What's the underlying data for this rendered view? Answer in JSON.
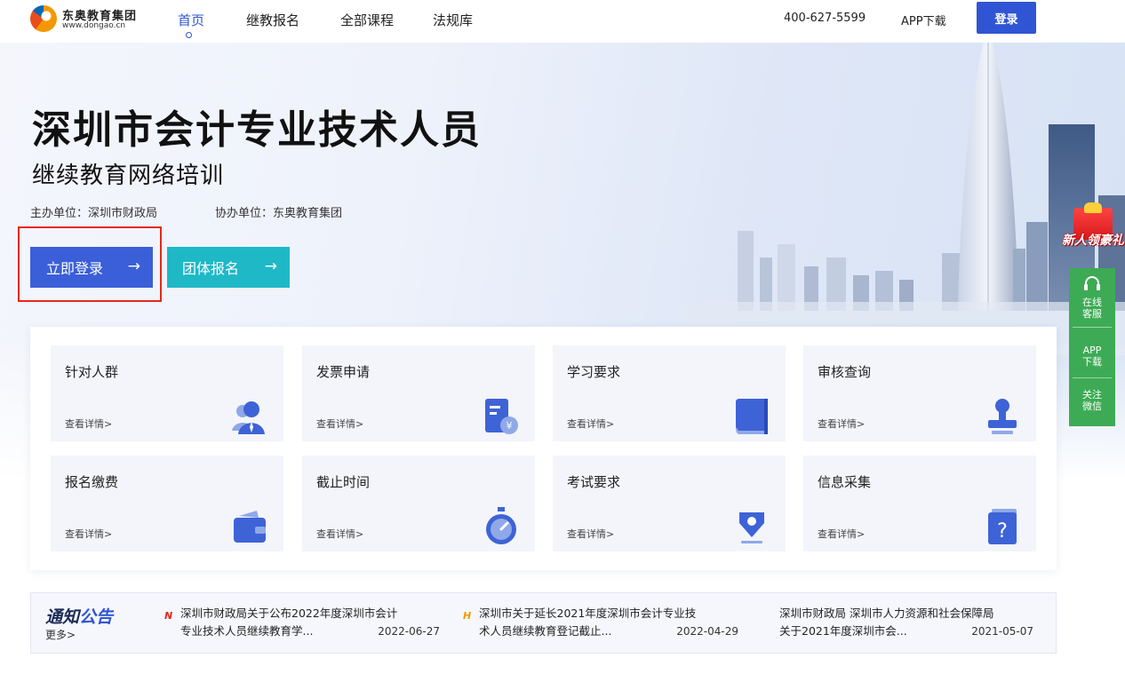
{
  "header": {
    "logo": {
      "name_cn": "东奥教育集团",
      "url_text": "www.dongao.cn"
    },
    "nav": [
      {
        "label": "首页",
        "active": true
      },
      {
        "label": "继教报名",
        "active": false
      },
      {
        "label": "全部课程",
        "active": false
      },
      {
        "label": "法规库",
        "active": false
      }
    ],
    "phone": "400-627-5599",
    "app_download": "APP下载",
    "login": "登录"
  },
  "hero": {
    "title": "深圳市会计专业技术人员",
    "subtitle": "继续教育网络培训",
    "organizer": "主办单位：深圳市财政局",
    "co_organizer": "协办单位：东奥教育集团",
    "cta_login": "立即登录",
    "cta_group": "团体报名",
    "arrow": "→"
  },
  "side": {
    "gift_text": "新人领豪礼",
    "items": [
      "在线\n客服",
      "APP\n下载",
      "关注\n微信"
    ]
  },
  "cards": [
    {
      "title": "针对人群",
      "link": "查看详情>",
      "icon": "people-icon"
    },
    {
      "title": "发票申请",
      "link": "查看详情>",
      "icon": "invoice-icon"
    },
    {
      "title": "学习要求",
      "link": "查看详情>",
      "icon": "book-icon"
    },
    {
      "title": "审核查询",
      "link": "查看详情>",
      "icon": "stamp-icon"
    },
    {
      "title": "报名缴费",
      "link": "查看详情>",
      "icon": "wallet-icon"
    },
    {
      "title": "截止时间",
      "link": "查看详情>",
      "icon": "stopwatch-icon"
    },
    {
      "title": "考试要求",
      "link": "查看详情>",
      "icon": "pen-icon"
    },
    {
      "title": "信息采集",
      "link": "查看详情>",
      "icon": "question-icon"
    }
  ],
  "notice": {
    "label_a": "通知",
    "label_b": "公告",
    "more": "更多>",
    "items": [
      {
        "badge": "N",
        "badge_color": "#e8261c",
        "line1": "深圳市财政局关于公布2022年度深圳市会计",
        "line2": "专业技术人员继续教育学...",
        "date": "2022-06-27"
      },
      {
        "badge": "H",
        "badge_color": "#f39800",
        "line1": "深圳市关于延长2021年度深圳市会计专业技",
        "line2": "术人员继续教育登记截止...",
        "date": "2022-04-29"
      },
      {
        "badge": "",
        "badge_color": "",
        "line1": "深圳市财政局 深圳市人力资源和社会保障局",
        "line2": "关于2021年度深圳市会...",
        "date": "2021-05-07"
      }
    ]
  },
  "colors": {
    "primary": "#2f55d4",
    "teal": "#1fb8c7",
    "green": "#3dab55",
    "highlight": "#e8261c"
  }
}
